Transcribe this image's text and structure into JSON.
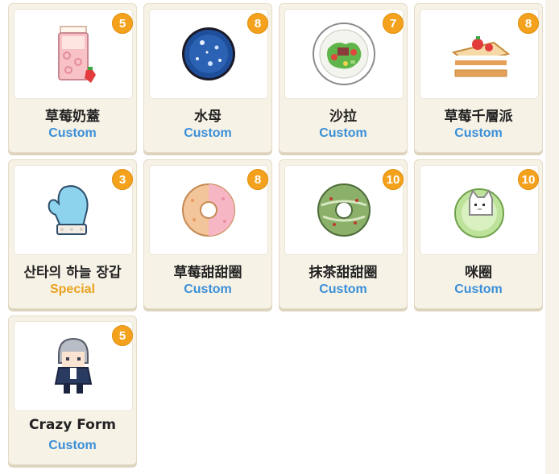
{
  "colors": {
    "badge": "#f4a21d",
    "custom_tag": "#3a8fd8",
    "special_tag": "#e9a21f",
    "card_bg": "#f7f2e6"
  },
  "items": [
    {
      "name": "草莓奶蓋",
      "tag": "Custom",
      "tag_type": "custom",
      "count": "5",
      "icon": "strawberry-milk-cap-icon"
    },
    {
      "name": "水母",
      "tag": "Custom",
      "tag_type": "custom",
      "count": "8",
      "icon": "jellyfish-orb-icon"
    },
    {
      "name": "沙拉",
      "tag": "Custom",
      "tag_type": "custom",
      "count": "7",
      "icon": "salad-plate-icon"
    },
    {
      "name": "草莓千層派",
      "tag": "Custom",
      "tag_type": "custom",
      "count": "8",
      "icon": "strawberry-mille-feuille-icon"
    },
    {
      "name": "산타의 하늘 장갑",
      "tag": "Special",
      "tag_type": "special",
      "count": "3",
      "icon": "mitten-icon"
    },
    {
      "name": "草莓甜甜圈",
      "tag": "Custom",
      "tag_type": "custom",
      "count": "8",
      "icon": "strawberry-donut-icon"
    },
    {
      "name": "抹茶甜甜圈",
      "tag": "Custom",
      "tag_type": "custom",
      "count": "10",
      "icon": "matcha-donut-icon"
    },
    {
      "name": "咪圈",
      "tag": "Custom",
      "tag_type": "custom",
      "count": "10",
      "icon": "cat-donut-icon"
    },
    {
      "name": "Crazy Form",
      "tag": "Custom",
      "tag_type": "custom",
      "count": "5",
      "icon": "character-avatar-icon"
    }
  ]
}
